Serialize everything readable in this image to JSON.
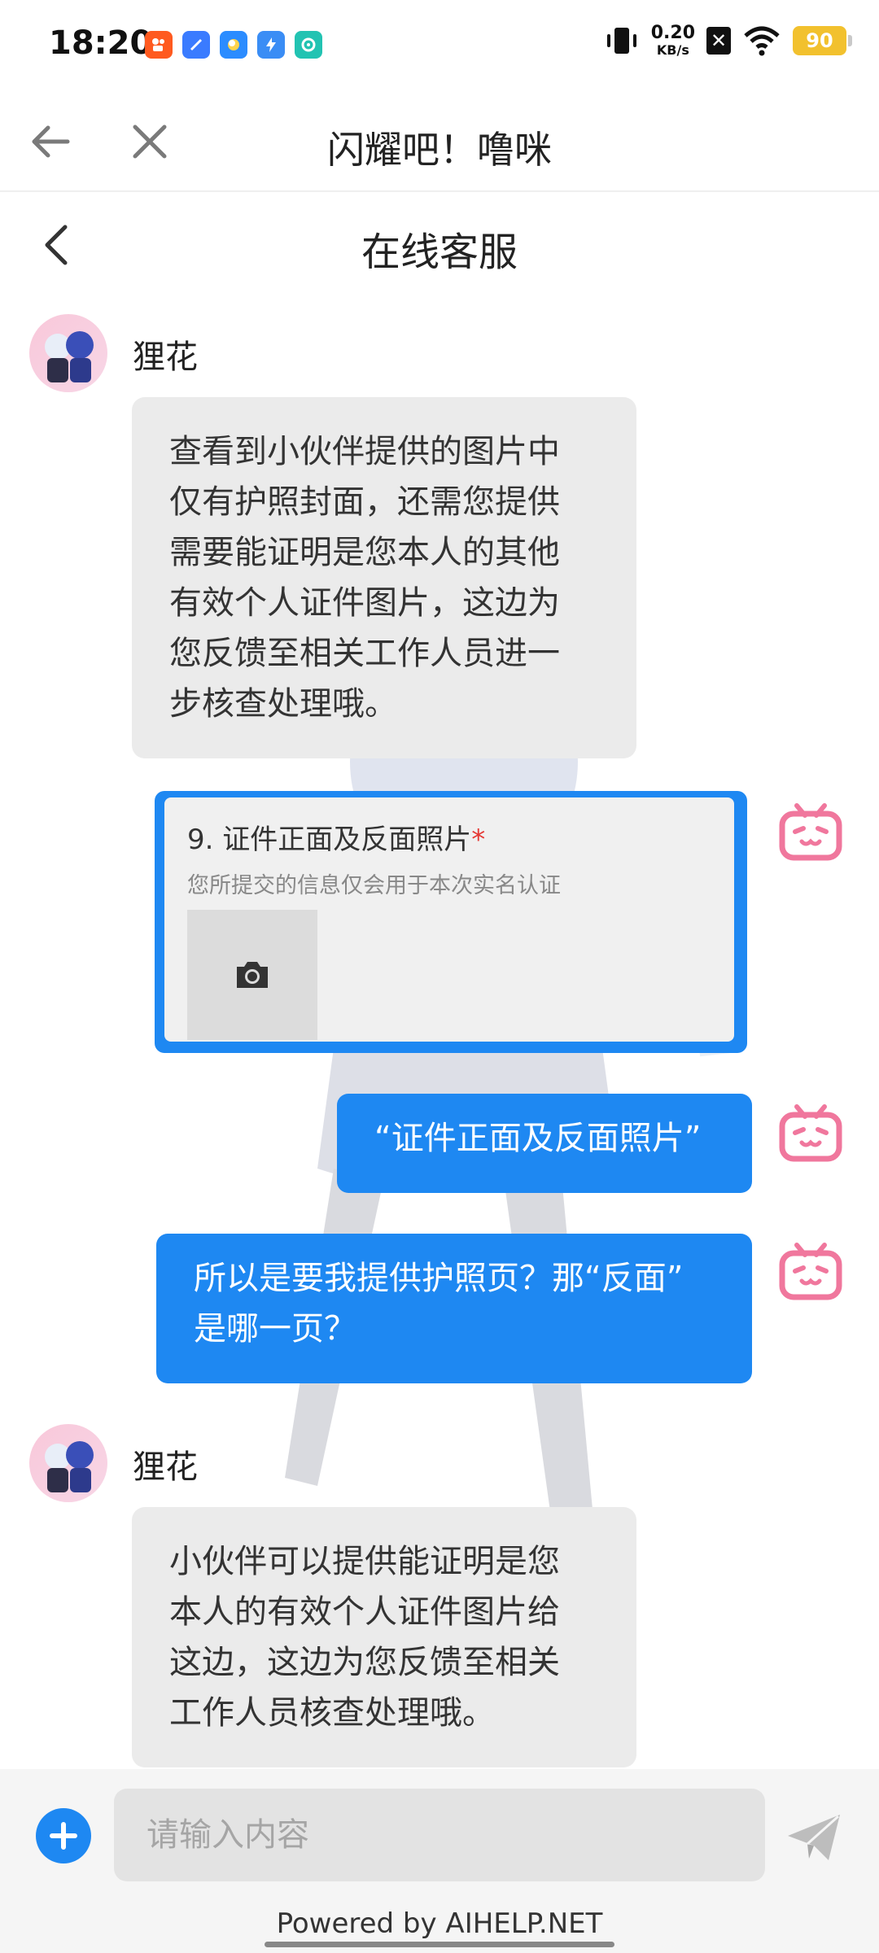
{
  "status_bar": {
    "time": "18:20",
    "app_icons": [
      "kuaishou-icon",
      "notes-icon",
      "qq-browser-icon",
      "blue-app-icon",
      "teal-app-icon"
    ],
    "net_speed_value": "0.20",
    "net_speed_unit": "KB/s",
    "battery": "90",
    "colors": {
      "battery": "#f2c12e"
    }
  },
  "browser": {
    "title": "闪耀吧！噜咪",
    "back_icon": "arrow-left-icon",
    "close_icon": "close-icon"
  },
  "page": {
    "title": "在线客服",
    "back_icon": "chevron-left-icon"
  },
  "messages": [
    {
      "sender": "agent",
      "name": "狸花",
      "lines": [
        "查看到小伙伴提供的图片中",
        "仅有护照封面，还需您提供",
        "需要能证明是您本人的其他",
        "有效个人证件图片，这边为",
        "您反馈至相关工作人员进一",
        "步核查处理哦。"
      ]
    },
    {
      "sender": "user",
      "type": "form",
      "question": "9. 证件正面及反面照片",
      "required_mark": "*",
      "note": "您所提交的信息仅会用于本次实名认证",
      "upload_icon": "camera-icon"
    },
    {
      "sender": "user",
      "text": "“证件正面及反面照片”"
    },
    {
      "sender": "user",
      "lines": [
        "所以是要我提供护照页？那“反面”",
        "是哪一页？"
      ]
    },
    {
      "sender": "agent",
      "name": "狸花",
      "lines": [
        "小伙伴可以提供能证明是您",
        "本人的有效个人证件图片给",
        "这边，这边为您反馈至相关",
        "工作人员核查处理哦。"
      ]
    }
  ],
  "input": {
    "placeholder": "请输入内容",
    "value": ""
  },
  "footer": {
    "powered_by": "Powered by AIHELP.NET"
  },
  "colors": {
    "user_bubble": "#1e88f2",
    "agent_bubble": "#ebebeb",
    "bilibili_pink": "#f0779d"
  }
}
